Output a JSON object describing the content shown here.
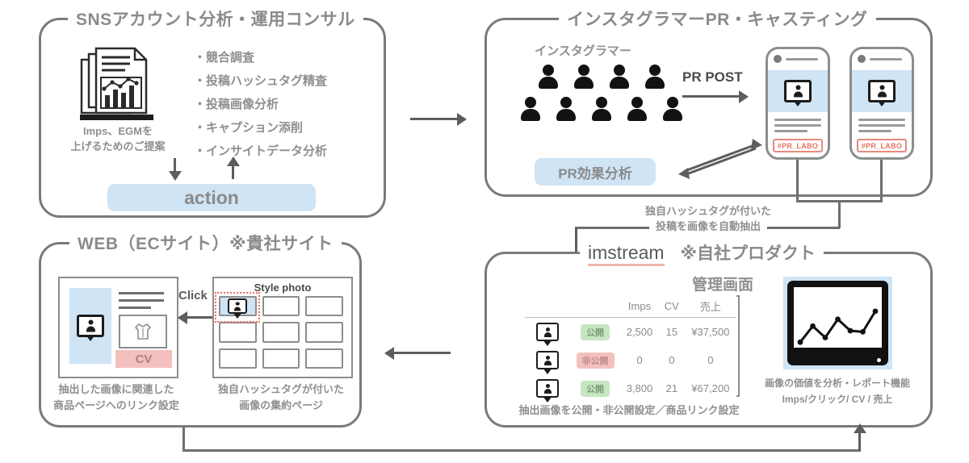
{
  "panels": {
    "sns": {
      "title": "SNSアカウント分析・運用コンサル",
      "icon_name": "report-document-icon",
      "icon_caption_l1": "Imps、EGMを",
      "icon_caption_l2": "上げるためのご提案",
      "bullets": [
        "・競合調査",
        "・投稿ハッシュタグ精査",
        "・投稿画像分析",
        "・キャプション添削",
        "・インサイトデータ分析"
      ],
      "action_label": "action"
    },
    "pr": {
      "title": "インスタグラマーPR・キャスティング",
      "crowd_label": "インスタグラマー",
      "post_arrow_label": "PR POST",
      "analysis_pill": "PR効果分析",
      "phones": [
        {
          "hashtag": "#PR_LABO"
        },
        {
          "hashtag": "#PR_LABO"
        }
      ]
    },
    "web": {
      "title": "WEB（ECサイト）※貴社サイト",
      "click_label": "Click",
      "style_photo_label": "Style photo",
      "cv_label": "CV",
      "caption_left_l1": "抽出した画像に関連した",
      "caption_left_l2": "商品ページへのリンク設定",
      "caption_right_l1": "独自ハッシュタグが付いた",
      "caption_right_l2": "画像の集約ページ"
    },
    "imstream": {
      "title_brand": "imstream",
      "title_note": "※自社プロダクト",
      "subtitle": "管理画面",
      "table": {
        "columns": [
          "",
          "",
          "Imps",
          "CV",
          "売上"
        ],
        "rows": [
          {
            "status": "公開",
            "status_type": "public",
            "imps": "2,500",
            "cv": "15",
            "sales": "¥37,500"
          },
          {
            "status": "非公開",
            "status_type": "private",
            "imps": "0",
            "cv": "0",
            "sales": "0"
          },
          {
            "status": "公開",
            "status_type": "public",
            "imps": "3,800",
            "cv": "21",
            "sales": "¥67,200"
          }
        ]
      },
      "table_caption": "抽出画像を公開・非公開設定／商品リンク設定",
      "report_caption_l1": "画像の価値を分析・レポート機能",
      "report_caption_l2": "Imps/クリック/ CV / 売上"
    }
  },
  "connectors": {
    "hashtag_note_l1": "独自ハッシュタグが付いた",
    "hashtag_note_l2": "投稿を画像を自動抽出"
  },
  "colors": {
    "accent_blue": "#cfe4f5",
    "accent_red": "#e8705f",
    "badge_green": "#c5e6c0",
    "badge_pink": "#f3c0bd",
    "line_gray": "#7a7a7a",
    "text_gray": "#8a8a8a"
  },
  "chart_data": {
    "type": "line",
    "title": "",
    "x": [
      0,
      1,
      2,
      3,
      4,
      5,
      6
    ],
    "values": [
      18,
      46,
      26,
      58,
      38,
      36,
      72
    ],
    "xlabel": "",
    "ylabel": "",
    "ylim": [
      0,
      100
    ]
  }
}
